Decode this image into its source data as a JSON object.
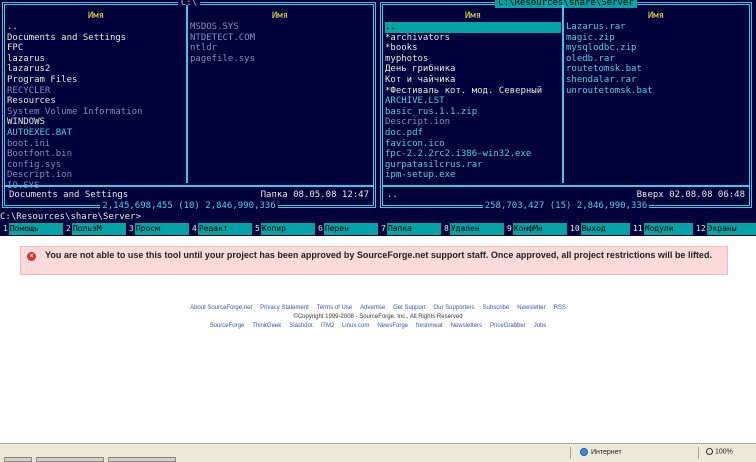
{
  "left_panel": {
    "path": "C:\\",
    "col1_header": "Имя",
    "col2_header": "Имя",
    "col1": [
      {
        "name": "..",
        "style": "w"
      },
      {
        "name": "Documents and Settings",
        "style": "w"
      },
      {
        "name": "FPC",
        "style": "w"
      },
      {
        "name": "lazarus",
        "style": "w"
      },
      {
        "name": "lazarus2",
        "style": "w"
      },
      {
        "name": "Program Files",
        "style": "w"
      },
      {
        "name": "RECYCLER",
        "style": "gray"
      },
      {
        "name": "Resources",
        "style": "w"
      },
      {
        "name": "System Volume Information",
        "style": "gray"
      },
      {
        "name": "WINDOWS",
        "style": "w"
      },
      {
        "name": "AUTOEXEC.BAT",
        "style": "c"
      },
      {
        "name": "boot.ini",
        "style": "gray"
      },
      {
        "name": "Bootfont.bin",
        "style": "gray"
      },
      {
        "name": "config.sys",
        "style": "gray"
      },
      {
        "name": "Descript.ion",
        "style": "gray"
      },
      {
        "name": "IO.SYS",
        "style": "gray"
      }
    ],
    "col2": [
      {
        "name": "MSDOS.SYS",
        "style": "gray"
      },
      {
        "name": "NTDETECT.COM",
        "style": "gray"
      },
      {
        "name": "ntldr",
        "style": "gray"
      },
      {
        "name": "pagefile.sys",
        "style": "gray"
      }
    ],
    "footer_name": "Documents and Settings",
    "footer_info": "Папка 08.05.08 12:47",
    "stats": "2,145,698,455 (10)  2,846,990,336"
  },
  "right_panel": {
    "path": "C:\\Resources\\share\\Server",
    "col1_header": "Имя",
    "col2_header": "Имя",
    "col1": [
      {
        "name": "..",
        "style": "sel"
      },
      {
        "name": "*archivators",
        "style": "w"
      },
      {
        "name": "*books",
        "style": "w"
      },
      {
        "name": "myphotos",
        "style": "w"
      },
      {
        "name": "День грибника",
        "style": "w"
      },
      {
        "name": "Кот и чайчика",
        "style": "w"
      },
      {
        "name": "*Фестиваль кот.  мод. Северный",
        "style": "w"
      },
      {
        "name": "ARCHIVE.LST",
        "style": "c"
      },
      {
        "name": "basic_rus.1.1.zip",
        "style": "c"
      },
      {
        "name": "Descript.ion",
        "style": "gray"
      },
      {
        "name": "doc.pdf",
        "style": "c"
      },
      {
        "name": "favicon.ico",
        "style": "c"
      },
      {
        "name": "fpc-2.2.2rc2.i386-win32.exe",
        "style": "c"
      },
      {
        "name": "gurpatasilcrus.rar",
        "style": "c"
      },
      {
        "name": "ipm-setup.exe",
        "style": "c"
      }
    ],
    "col2": [
      {
        "name": "Lazarus.rar",
        "style": "c"
      },
      {
        "name": "magic.zip",
        "style": "c"
      },
      {
        "name": "mysqlodbc.zip",
        "style": "c"
      },
      {
        "name": "oledb.rar",
        "style": "c"
      },
      {
        "name": "routetomsk.bat",
        "style": "c"
      },
      {
        "name": "shendalar.rar",
        "style": "c"
      },
      {
        "name": "unroutetomsk.bat",
        "style": "c"
      }
    ],
    "footer_name": "..",
    "footer_info": "Вверх 02.08.08 06:48",
    "stats": "258,703,427 (15)  2,846,990,336"
  },
  "command_line": "C:\\Resources\\share\\Server>",
  "fkeys": [
    {
      "num": "1",
      "label": "Помощь"
    },
    {
      "num": "2",
      "label": "ПользМ"
    },
    {
      "num": "3",
      "label": "Просм"
    },
    {
      "num": "4",
      "label": "Редакт"
    },
    {
      "num": "5",
      "label": "Копир"
    },
    {
      "num": "6",
      "label": "Перен"
    },
    {
      "num": "7",
      "label": "Папка"
    },
    {
      "num": "8",
      "label": "Удален"
    },
    {
      "num": "9",
      "label": "КонфМн"
    },
    {
      "num": "10",
      "label": "Выход"
    },
    {
      "num": "11",
      "label": "Модули"
    },
    {
      "num": "12",
      "label": "Экраны"
    }
  ],
  "alert": {
    "icon": "error-icon",
    "text": "You are not able to use this tool until your project has been approved by SourceForge.net support staff. Once approved, all project restrictions will be lifted."
  },
  "footer_links_1": [
    "About SourceForge.net",
    "Privacy Statement",
    "Terms of Use",
    "Advertise",
    "Get Support",
    "Our Supporters",
    "Subscribe",
    "Newsletter",
    "RSS"
  ],
  "copyright": "©Copyright 1999-2008 - SourceForge, Inc., All Rights Reserved",
  "footer_links_2": [
    "SourceForge",
    "ThinkGeek",
    "Slashdot",
    "ITMJ",
    "Linux.com",
    "NewsForge",
    "freshmeat",
    "Newsletters",
    "PriceGrabber",
    "Jobs"
  ],
  "statusbar": {
    "zone": "Интернет",
    "zoom": "100%"
  },
  "colors": {
    "console_bg": "#00003a",
    "frame": "#3ec7e6",
    "cursor": "#00a3a3",
    "header": "#f0e646",
    "alert_bg": "#fbdadb"
  }
}
